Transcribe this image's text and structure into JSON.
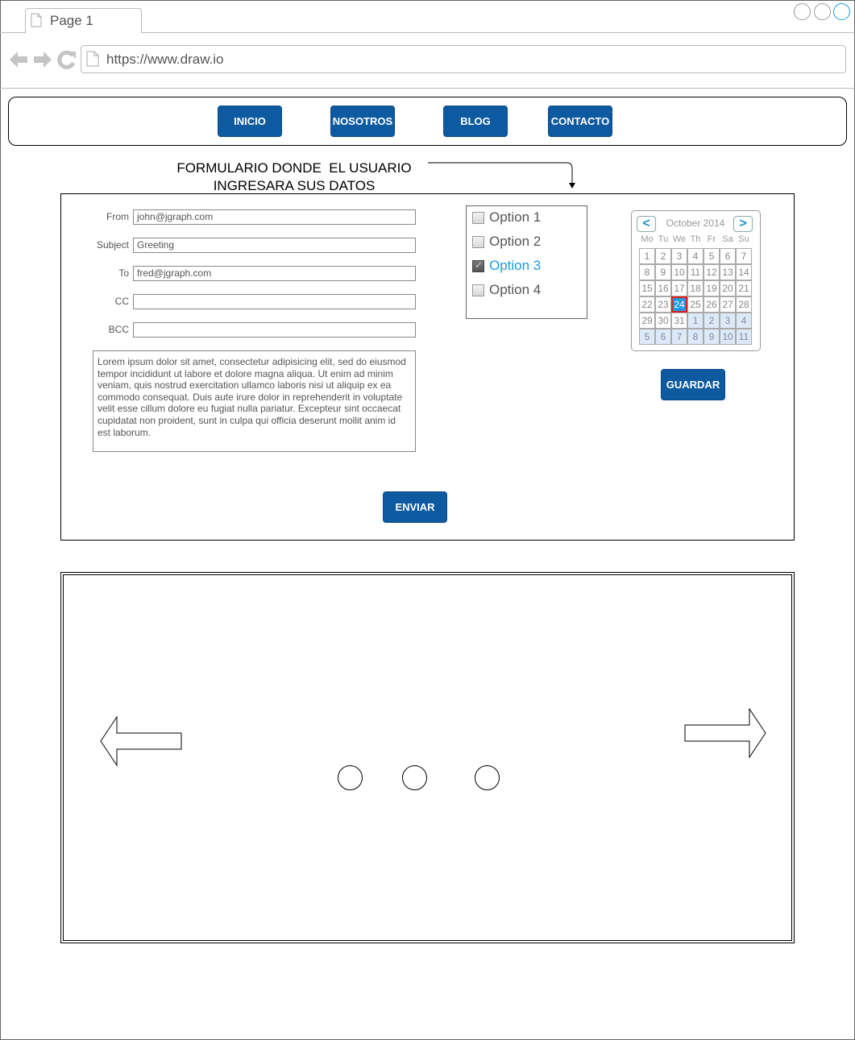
{
  "browser": {
    "tab_title": "Page 1",
    "url": "https://www.draw.io",
    "colors": {
      "accent": "#1a9cde",
      "chrome": "#bbbbbb"
    }
  },
  "nav": {
    "items": [
      "INICIO",
      "NOSOTROS",
      "BLOG",
      "CONTACTO"
    ],
    "button_color": "#0e5aa0"
  },
  "annotation": {
    "line1": "FORMULARIO DONDE  EL USUARIO",
    "line2": "INGRESARA SUS DATOS"
  },
  "form": {
    "fields": [
      {
        "label": "From",
        "value": "john@jgraph.com"
      },
      {
        "label": "Subject",
        "value": "Greeting"
      },
      {
        "label": "To",
        "value": "fred@jgraph.com"
      },
      {
        "label": "CC",
        "value": ""
      },
      {
        "label": "BCC",
        "value": ""
      }
    ],
    "message": "Lorem ipsum dolor sit amet, consectetur adipisicing elit, sed do eiusmod tempor incididunt ut labore et dolore magna aliqua. Ut enim ad minim veniam, quis nostrud exercitation ullamco laboris nisi ut aliquip ex ea commodo consequat. Duis aute irure dolor in reprehenderit in voluptate velit esse cillum dolore eu fugiat nulla pariatur. Excepteur sint occaecat cupidatat non proident, sunt in culpa qui officia deserunt mollit anim id est laborum.",
    "send_label": "ENVIAR"
  },
  "options": [
    {
      "label": "Option 1",
      "checked": false
    },
    {
      "label": "Option 2",
      "checked": false
    },
    {
      "label": "Option 3",
      "checked": true
    },
    {
      "label": "Option 4",
      "checked": false
    }
  ],
  "calendar": {
    "prev": "<",
    "next": ">",
    "title": "October 2014",
    "weekdays": [
      "Mo",
      "Tu",
      "We",
      "Th",
      "Fr",
      "Sa",
      "Su"
    ],
    "weeks": [
      [
        "1",
        "2",
        "3",
        "4",
        "5",
        "6",
        "7"
      ],
      [
        "8",
        "9",
        "10",
        "11",
        "12",
        "13",
        "14"
      ],
      [
        "15",
        "16",
        "17",
        "18",
        "19",
        "20",
        "21"
      ],
      [
        "22",
        "23",
        "24",
        "25",
        "26",
        "27",
        "28"
      ],
      [
        "29",
        "30",
        "31",
        "1",
        "2",
        "3",
        "4"
      ],
      [
        "5",
        "6",
        "7",
        "8",
        "9",
        "10",
        "11"
      ]
    ],
    "selected_day": "24",
    "save_label": "GUARDAR"
  },
  "carousel": {
    "prev_icon": "left-arrow-icon",
    "next_icon": "right-arrow-icon",
    "indicator_count": 3
  }
}
